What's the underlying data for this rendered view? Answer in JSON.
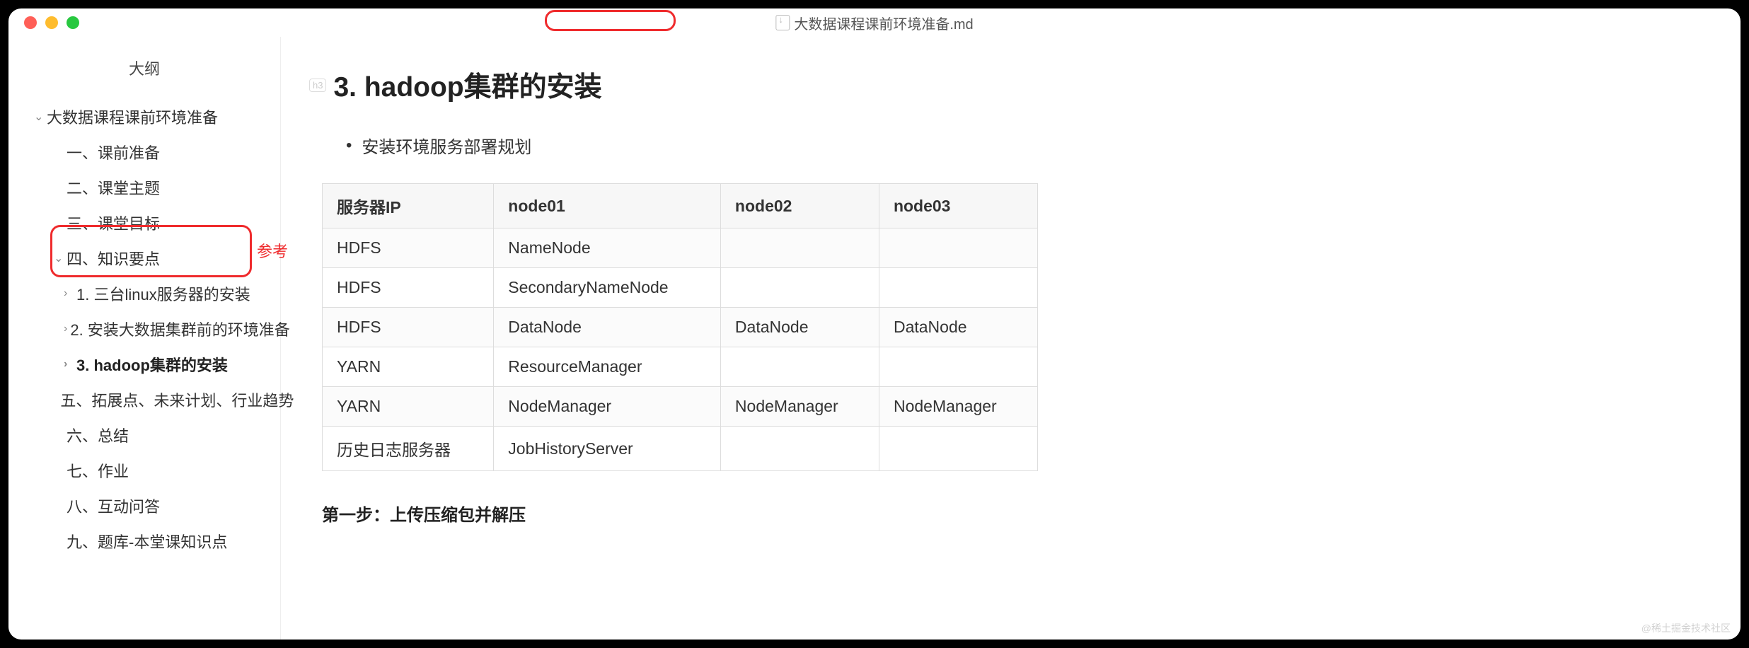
{
  "window": {
    "filename": "大数据课程课前环境准备.md"
  },
  "sidebar": {
    "title": "大纲",
    "items": [
      {
        "label": "大数据课程课前环境准备",
        "level": 1,
        "chev": "down"
      },
      {
        "label": "一、课前准备",
        "level": 2,
        "chev": "none"
      },
      {
        "label": "二、课堂主题",
        "level": 2,
        "chev": "none"
      },
      {
        "label": "三、课堂目标",
        "level": 2,
        "chev": "none"
      },
      {
        "label": "四、知识要点",
        "level": 2,
        "chev": "down"
      },
      {
        "label": "1. 三台linux服务器的安装",
        "level": 3,
        "chev": "right"
      },
      {
        "label": "2. 安装大数据集群前的环境准备",
        "level": 3,
        "chev": "right"
      },
      {
        "label": "3. hadoop集群的安装",
        "level": 3,
        "chev": "right",
        "bold": true
      },
      {
        "label": "五、拓展点、未来计划、行业趋势",
        "level": 2,
        "chev": "none"
      },
      {
        "label": "六、总结",
        "level": 2,
        "chev": "none"
      },
      {
        "label": "七、作业",
        "level": 2,
        "chev": "none"
      },
      {
        "label": "八、互动问答",
        "level": 2,
        "chev": "none"
      },
      {
        "label": "九、题库-本堂课知识点",
        "level": 2,
        "chev": "none"
      }
    ]
  },
  "main": {
    "h3_badge": "h3",
    "heading": "3. hadoop集群的安装",
    "bullet": "安装环境服务部署规划",
    "step": "第一步：上传压缩包并解压"
  },
  "annotations": {
    "ref_label": "参考"
  },
  "chart_data": {
    "type": "table",
    "headers": [
      "服务器IP",
      "node01",
      "node02",
      "node03"
    ],
    "rows": [
      [
        "HDFS",
        "NameNode",
        "",
        ""
      ],
      [
        "HDFS",
        "SecondaryNameNode",
        "",
        ""
      ],
      [
        "HDFS",
        "DataNode",
        "DataNode",
        "DataNode"
      ],
      [
        "YARN",
        "ResourceManager",
        "",
        ""
      ],
      [
        "YARN",
        "NodeManager",
        "NodeManager",
        "NodeManager"
      ],
      [
        "历史日志服务器",
        "JobHistoryServer",
        "",
        ""
      ]
    ]
  },
  "watermark": "@稀土掘金技术社区"
}
